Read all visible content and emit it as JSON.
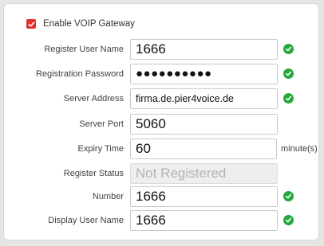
{
  "enable_voip": {
    "label": "Enable VOIP Gateway",
    "checked": true
  },
  "fields": {
    "register_user_name": {
      "label": "Register User Name",
      "value": "1666",
      "valid": true
    },
    "registration_password": {
      "label": "Registration Password",
      "value": "●●●●●●●●●●",
      "valid": true
    },
    "server_address": {
      "label": "Server Address",
      "value": "firma.de.pier4voice.de",
      "valid": true
    },
    "server_port": {
      "label": "Server Port",
      "value": "5060"
    },
    "expiry_time": {
      "label": "Expiry Time",
      "value": "60",
      "unit": "minute(s)"
    },
    "register_status": {
      "label": "Register Status",
      "value": "Not Registered"
    },
    "number": {
      "label": "Number",
      "value": "1666",
      "valid": true
    },
    "display_user_name": {
      "label": "Display User Name",
      "value": "1666",
      "valid": true
    }
  },
  "colors": {
    "accent": "#e0312e",
    "valid": "#24a83b"
  },
  "icons": {
    "valid": "check-circle-icon",
    "checkbox": "checkbox-checked-icon"
  }
}
